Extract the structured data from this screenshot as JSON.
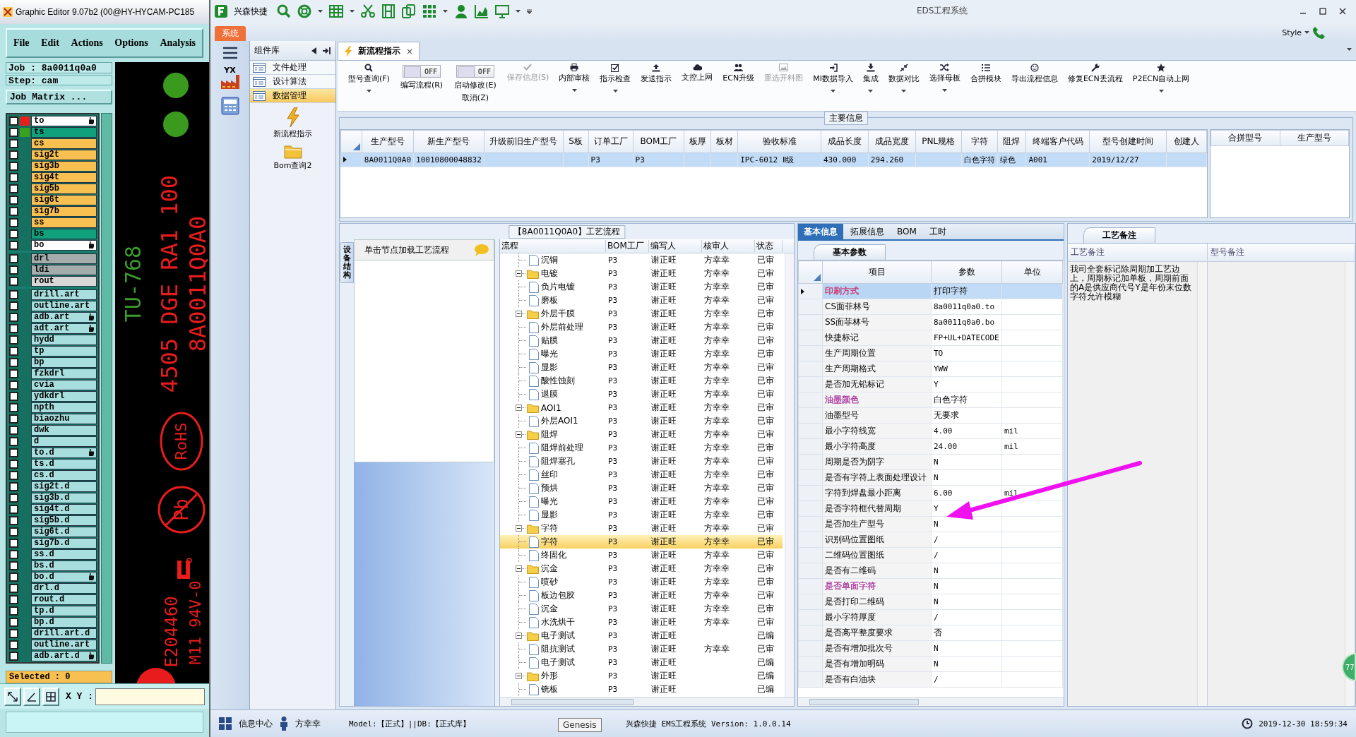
{
  "genesis": {
    "title": "Graphic Editor 9.07b2 (00@HY-HYCAM-PC185",
    "menu": [
      "File",
      "Edit",
      "Actions",
      "Options",
      "Analysis"
    ],
    "job": "Job : 8a0011q0a0",
    "step": "Step: cam",
    "matrix_button": "Job Matrix ...",
    "layer_groups": [
      [
        {
          "name": "to",
          "color": "#ffffff",
          "hand": true,
          "checked": false,
          "marker": {
            "color": "#e8201c"
          }
        },
        {
          "name": "ts",
          "color": "#10a07c",
          "hand": false,
          "checked": false,
          "marker": {
            "color": "#3aa020"
          }
        },
        {
          "name": "cs",
          "color": "#f8c050",
          "hand": false,
          "checked": false
        },
        {
          "name": "sig2t",
          "color": "#f8c050",
          "hand": false,
          "checked": false
        },
        {
          "name": "sig3b",
          "color": "#f8c050",
          "hand": false,
          "checked": false
        },
        {
          "name": "sig4t",
          "color": "#f8c050",
          "hand": false,
          "checked": false
        },
        {
          "name": "sig5b",
          "color": "#f8c050",
          "hand": false,
          "checked": false
        },
        {
          "name": "sig6t",
          "color": "#f8c050",
          "hand": false,
          "checked": false
        },
        {
          "name": "sig7b",
          "color": "#f8c050",
          "hand": false,
          "checked": false
        },
        {
          "name": "ss",
          "color": "#f8c050",
          "hand": false,
          "checked": false
        },
        {
          "name": "bs",
          "color": "#10a07c",
          "hand": false,
          "checked": false
        },
        {
          "name": "bo",
          "color": "#ffffff",
          "hand": true,
          "checked": false
        }
      ],
      [
        {
          "name": "drl",
          "color": "#a4acac",
          "hand": false,
          "checked": false
        },
        {
          "name": "ldi",
          "color": "#a4acac",
          "hand": false,
          "checked": false
        },
        {
          "name": "rout",
          "color": "#d8d8d8",
          "hand": false,
          "checked": false
        }
      ],
      [
        {
          "name": "drill.art",
          "color": "#a8dede",
          "hand": false,
          "checked": false
        },
        {
          "name": "outline.art",
          "color": "#a8dede",
          "hand": false,
          "checked": false
        },
        {
          "name": "adb.art",
          "color": "#a8dede",
          "hand": true,
          "checked": false
        },
        {
          "name": "adt.art",
          "color": "#a8dede",
          "hand": true,
          "checked": false
        },
        {
          "name": "hydd",
          "color": "#a8dede",
          "hand": false,
          "checked": false
        },
        {
          "name": "tp",
          "color": "#a8dede",
          "hand": false,
          "checked": false
        },
        {
          "name": "bp",
          "color": "#a8dede",
          "hand": false,
          "checked": false
        },
        {
          "name": "fzkdrl",
          "color": "#a8dede",
          "hand": false,
          "checked": false
        },
        {
          "name": "cvia",
          "color": "#a8dede",
          "hand": false,
          "checked": false
        },
        {
          "name": "ydkdrl",
          "color": "#a8dede",
          "hand": false,
          "checked": false
        },
        {
          "name": "npth",
          "color": "#a8dede",
          "hand": false,
          "checked": false
        },
        {
          "name": "biaozhu",
          "color": "#a8dede",
          "hand": false,
          "checked": false
        },
        {
          "name": "dwk",
          "color": "#a8dede",
          "hand": false,
          "checked": false
        },
        {
          "name": "d",
          "color": "#a8dede",
          "hand": false,
          "checked": false
        },
        {
          "name": "to.d",
          "color": "#a8dede",
          "hand": true,
          "checked": false
        },
        {
          "name": "ts.d",
          "color": "#a8dede",
          "hand": false,
          "checked": false
        },
        {
          "name": "cs.d",
          "color": "#a8dede",
          "hand": false,
          "checked": false
        },
        {
          "name": "sig2t.d",
          "color": "#a8dede",
          "hand": false,
          "checked": false
        },
        {
          "name": "sig3b.d",
          "color": "#a8dede",
          "hand": false,
          "checked": false
        },
        {
          "name": "sig4t.d",
          "color": "#a8dede",
          "hand": false,
          "checked": false
        },
        {
          "name": "sig5b.d",
          "color": "#a8dede",
          "hand": false,
          "checked": false
        },
        {
          "name": "sig6t.d",
          "color": "#a8dede",
          "hand": false,
          "checked": false
        },
        {
          "name": "sig7b.d",
          "color": "#a8dede",
          "hand": false,
          "checked": false
        },
        {
          "name": "ss.d",
          "color": "#a8dede",
          "hand": false,
          "checked": false
        },
        {
          "name": "bs.d",
          "color": "#a8dede",
          "hand": false,
          "checked": false
        },
        {
          "name": "bo.d",
          "color": "#a8dede",
          "hand": true,
          "checked": false
        },
        {
          "name": "drl.d",
          "color": "#a8dede",
          "hand": false,
          "checked": false
        },
        {
          "name": "rout.d",
          "color": "#a8dede",
          "hand": false,
          "checked": false
        },
        {
          "name": "tp.d",
          "color": "#a8dede",
          "hand": false,
          "checked": false
        },
        {
          "name": "bp.d",
          "color": "#a8dede",
          "hand": false,
          "checked": false
        },
        {
          "name": "drill.art.d",
          "color": "#a8dede",
          "hand": false,
          "checked": false
        },
        {
          "name": "outline.art",
          "color": "#a8dede",
          "hand": false,
          "checked": false
        },
        {
          "name": "adb.art.d",
          "color": "#a8dede",
          "hand": true,
          "checked": false
        }
      ]
    ],
    "selected": "Selected : 0",
    "xy_label": "X Y :",
    "canvas_texts": [
      {
        "kind": "line",
        "text": "TU-768",
        "color": "#3c9c2c"
      },
      {
        "kind": "line",
        "text": "4505 DGE RA1 100",
        "color": "#e81c1c"
      },
      {
        "kind": "line",
        "text": "8A0011Q0A0",
        "color": "#e81c1c"
      },
      {
        "kind": "rohs",
        "text": "RoHS",
        "color": "#e81c1c"
      },
      {
        "kind": "pb",
        "text": "Pb",
        "color": "#e81c1c"
      },
      {
        "kind": "line",
        "text": "E204460",
        "color": "#e81c1c"
      },
      {
        "kind": "line",
        "text": "M11 94V-0",
        "color": "#e81c1c"
      }
    ]
  },
  "app": {
    "brand": "兴森快捷",
    "title": "EDS工程系统",
    "system_tab": "系统",
    "style_menu": "Style",
    "nav_logo": "YX"
  },
  "library": {
    "header": "组件库",
    "items": [
      {
        "label": "文件处理",
        "selected": false
      },
      {
        "label": "设计算法",
        "selected": false
      },
      {
        "label": "数据管理",
        "selected": true
      }
    ],
    "shortcuts": [
      "新流程指示",
      "Bom查询2"
    ]
  },
  "doc_tab": {
    "label": "新流程指示",
    "close": "×"
  },
  "ribbon": [
    {
      "kind": "button",
      "label": "型号查询(F)",
      "dropdown": true,
      "disabled": false
    },
    {
      "kind": "toggle",
      "label": "编写流程(R)",
      "toggle_text": "OFF",
      "on": false
    },
    {
      "kind": "toggle",
      "label": "启动修改(E)",
      "sublabel": "取消(Z)",
      "toggle_text": "OFF",
      "on": false
    },
    {
      "kind": "button",
      "label": "保存信息(S)",
      "dropdown": false,
      "disabled": true
    },
    {
      "kind": "button",
      "label": "内部审核",
      "dropdown": true,
      "disabled": false
    },
    {
      "kind": "button",
      "label": "指示检查",
      "dropdown": true,
      "disabled": false
    },
    {
      "kind": "button",
      "label": "发送指示",
      "dropdown": false,
      "disabled": false
    },
    {
      "kind": "button",
      "label": "文控上网",
      "dropdown": false,
      "disabled": false
    },
    {
      "kind": "button",
      "label": "ECN升级",
      "dropdown": false,
      "disabled": false
    },
    {
      "kind": "button",
      "label": "重选开料图",
      "dropdown": false,
      "disabled": true
    },
    {
      "kind": "button",
      "label": "MI数据导入",
      "dropdown": true,
      "disabled": false
    },
    {
      "kind": "button",
      "label": "集成",
      "dropdown": true,
      "disabled": false
    },
    {
      "kind": "button",
      "label": "数据对比",
      "dropdown": true,
      "disabled": false
    },
    {
      "kind": "button",
      "label": "选择母板",
      "dropdown": true,
      "disabled": false
    },
    {
      "kind": "button",
      "label": "合拼模块",
      "dropdown": false,
      "disabled": false
    },
    {
      "kind": "button",
      "label": "导出流程信息",
      "dropdown": false,
      "disabled": false
    },
    {
      "kind": "button",
      "label": "修复ECN丢流程",
      "dropdown": false,
      "disabled": false
    },
    {
      "kind": "button",
      "label": "P2ECN自动上网",
      "dropdown": true,
      "disabled": false
    }
  ],
  "main_info": {
    "title": "主要信息",
    "columns": [
      "生产型号",
      "新生产型号",
      "升级前旧生产型号",
      "S板",
      "订单工厂",
      "BOM工厂",
      "板厚",
      "板材",
      "验收标准",
      "成品长度",
      "成品宽度",
      "PNL规格",
      "字符",
      "阻焊",
      "终端客户代码",
      "型号创建时间",
      "创建人"
    ],
    "rows": [
      {
        "selected": true,
        "cells": [
          "8A0011Q0A0",
          "10010800048832",
          null,
          null,
          "P3",
          "P3",
          null,
          null,
          "IPC-6012 Ⅱ级",
          "430.000",
          "294.260",
          null,
          "白色字符",
          "绿色",
          "A001",
          "2019/12/27",
          null
        ]
      }
    ],
    "side_columns": [
      "合拼型号",
      "生产型号"
    ]
  },
  "process": {
    "title": "【8A0011Q0A0】工艺流程",
    "side_tab": "设备结构",
    "hint": "单击节点加载工艺流程",
    "columns": [
      "流程",
      "BOM工厂",
      "编写人",
      "核审人",
      "状态"
    ],
    "rows": [
      {
        "kind": "file",
        "label": "沉铜",
        "selected": false,
        "bom": "P3",
        "writer": "谢正旺",
        "reviewer": "方幸幸",
        "status": "已审"
      },
      {
        "kind": "folder",
        "label": "电镀",
        "expanded": true,
        "selected": false,
        "bom": "P3",
        "writer": "谢正旺",
        "reviewer": "方幸幸",
        "status": "已审",
        "children": [
          {
            "kind": "file",
            "label": "负片电镀",
            "selected": false,
            "bom": "P3",
            "writer": "谢正旺",
            "reviewer": "方幸幸",
            "status": "已审"
          },
          {
            "kind": "file",
            "label": "磨板",
            "selected": false,
            "bom": "P3",
            "writer": "谢正旺",
            "reviewer": "方幸幸",
            "status": "已审"
          }
        ]
      },
      {
        "kind": "folder",
        "label": "外层干膜",
        "expanded": true,
        "selected": false,
        "bom": "P3",
        "writer": "谢正旺",
        "reviewer": "方幸幸",
        "status": "已审",
        "children": [
          {
            "kind": "file",
            "label": "外层前处理",
            "selected": false,
            "bom": "P3",
            "writer": "谢正旺",
            "reviewer": "方幸幸",
            "status": "已审"
          },
          {
            "kind": "file",
            "label": "贴膜",
            "selected": false,
            "bom": "P3",
            "writer": "谢正旺",
            "reviewer": "方幸幸",
            "status": "已审"
          },
          {
            "kind": "file",
            "label": "曝光",
            "selected": false,
            "bom": "P3",
            "writer": "谢正旺",
            "reviewer": "方幸幸",
            "status": "已审"
          },
          {
            "kind": "file",
            "label": "显影",
            "selected": false,
            "bom": "P3",
            "writer": "谢正旺",
            "reviewer": "方幸幸",
            "status": "已审"
          },
          {
            "kind": "file",
            "label": "酸性蚀刻",
            "selected": false,
            "bom": "P3",
            "writer": "谢正旺",
            "reviewer": "方幸幸",
            "status": "已审"
          },
          {
            "kind": "file",
            "label": "退膜",
            "selected": false,
            "bom": "P3",
            "writer": "谢正旺",
            "reviewer": "方幸幸",
            "status": "已审"
          }
        ]
      },
      {
        "kind": "folder",
        "label": "AOI1",
        "expanded": true,
        "selected": false,
        "bom": "P3",
        "writer": "谢正旺",
        "reviewer": "方幸幸",
        "status": "已审",
        "children": [
          {
            "kind": "file",
            "label": "外层AOI1",
            "selected": false,
            "bom": "P3",
            "writer": "谢正旺",
            "reviewer": "方幸幸",
            "status": "已审"
          }
        ]
      },
      {
        "kind": "folder",
        "label": "阻焊",
        "expanded": true,
        "selected": false,
        "bom": "P3",
        "writer": "谢正旺",
        "reviewer": "方幸幸",
        "status": "已审",
        "children": [
          {
            "kind": "file",
            "label": "阻焊前处理",
            "selected": false,
            "bom": "P3",
            "writer": "谢正旺",
            "reviewer": "方幸幸",
            "status": "已审"
          },
          {
            "kind": "file",
            "label": "阻焊塞孔",
            "selected": false,
            "bom": "P3",
            "writer": "谢正旺",
            "reviewer": "方幸幸",
            "status": "已审"
          },
          {
            "kind": "file",
            "label": "丝印",
            "selected": false,
            "bom": "P3",
            "writer": "谢正旺",
            "reviewer": "方幸幸",
            "status": "已审"
          },
          {
            "kind": "file",
            "label": "预烘",
            "selected": false,
            "bom": "P3",
            "writer": "谢正旺",
            "reviewer": "方幸幸",
            "status": "已审"
          },
          {
            "kind": "file",
            "label": "曝光",
            "selected": false,
            "bom": "P3",
            "writer": "谢正旺",
            "reviewer": "方幸幸",
            "status": "已审"
          },
          {
            "kind": "file",
            "label": "显影",
            "selected": false,
            "bom": "P3",
            "writer": "谢正旺",
            "reviewer": "方幸幸",
            "status": "已审"
          }
        ]
      },
      {
        "kind": "folder",
        "label": "字符",
        "expanded": true,
        "selected": false,
        "bom": "P3",
        "writer": "谢正旺",
        "reviewer": "方幸幸",
        "status": "已审",
        "children": [
          {
            "kind": "file",
            "label": "字符",
            "selected": true,
            "bom": "P3",
            "writer": "谢正旺",
            "reviewer": "方幸幸",
            "status": "已审"
          },
          {
            "kind": "file",
            "label": "终固化",
            "selected": false,
            "bom": "P3",
            "writer": "谢正旺",
            "reviewer": "方幸幸",
            "status": "已审"
          }
        ]
      },
      {
        "kind": "folder",
        "label": "沉金",
        "expanded": true,
        "selected": false,
        "bom": "P3",
        "writer": "谢正旺",
        "reviewer": "方幸幸",
        "status": "已审",
        "children": [
          {
            "kind": "file",
            "label": "喷砂",
            "selected": false,
            "bom": "P3",
            "writer": "谢正旺",
            "reviewer": "方幸幸",
            "status": "已审"
          },
          {
            "kind": "file",
            "label": "板边包胶",
            "selected": false,
            "bom": "P3",
            "writer": "谢正旺",
            "reviewer": "方幸幸",
            "status": "已审"
          },
          {
            "kind": "file",
            "label": "沉金",
            "selected": false,
            "bom": "P3",
            "writer": "谢正旺",
            "reviewer": "方幸幸",
            "status": "已审"
          },
          {
            "kind": "file",
            "label": "水洗烘干",
            "selected": false,
            "bom": "P3",
            "writer": "谢正旺",
            "reviewer": "方幸幸",
            "status": "已审"
          }
        ]
      },
      {
        "kind": "folder",
        "label": "电子测试",
        "expanded": true,
        "selected": false,
        "bom": "P3",
        "writer": "谢正旺",
        "status": "已编",
        "children": [
          {
            "kind": "file",
            "label": "阻抗测试",
            "selected": false,
            "bom": "P3",
            "writer": "谢正旺",
            "reviewer": "方幸幸",
            "status": "已审"
          },
          {
            "kind": "file",
            "label": "电子测试",
            "selected": false,
            "bom": "P3",
            "writer": "谢正旺",
            "status": "已编"
          }
        ]
      },
      {
        "kind": "folder",
        "label": "外形",
        "expanded": true,
        "selected": false,
        "bom": "P3",
        "writer": "谢正旺",
        "status": "已编",
        "children": [
          {
            "kind": "file",
            "label": "铣板",
            "selected": false,
            "bom": "P3",
            "writer": "谢正旺",
            "status": "已编"
          }
        ]
      }
    ]
  },
  "details": {
    "tabs": [
      {
        "label": "基本信息",
        "selected": true
      },
      {
        "label": "拓展信息",
        "selected": false
      },
      {
        "label": "BOM",
        "selected": false
      },
      {
        "label": "工时",
        "selected": false
      }
    ],
    "group_tab": "基本参数",
    "columns": [
      "项目",
      "参数",
      "单位"
    ],
    "rows": [
      {
        "name": "印刷方式",
        "value": "打印字符",
        "color": "#c8306c",
        "selected": true
      },
      {
        "name": "CS面菲林号",
        "value": "8a0011q0a0.to",
        "selected": false
      },
      {
        "name": "SS面菲林号",
        "value": "8a0011q0a0.bo",
        "selected": false
      },
      {
        "name": "快捷标记",
        "value": "FP+UL+DATECODE",
        "selected": false
      },
      {
        "name": "生产周期位置",
        "value": "TO",
        "selected": false
      },
      {
        "name": "生产周期格式",
        "value": "YWW",
        "selected": false
      },
      {
        "name": "是否加无铅标记",
        "value": "Y",
        "selected": false
      },
      {
        "name": "油墨颜色",
        "value": "白色字符",
        "color": "#a8309c",
        "selected": false
      },
      {
        "name": "油墨型号",
        "value": "无要求",
        "selected": false
      },
      {
        "name": "最小字符线宽",
        "value": "4.00",
        "unit": "mil",
        "selected": false
      },
      {
        "name": "最小字符高度",
        "value": "24.00",
        "unit": "mil",
        "selected": false
      },
      {
        "name": "周期是否为阴字",
        "value": "N",
        "selected": false
      },
      {
        "name": "是否有字符上表面处理设计",
        "value": "N",
        "selected": false
      },
      {
        "name": "字符到焊盘最小距离",
        "value": "6.00",
        "unit": "mil",
        "selected": false
      },
      {
        "name": "是否字符框代替周期",
        "value": "Y",
        "selected": false
      },
      {
        "name": "是否加生产型号",
        "value": "N",
        "selected": false
      },
      {
        "name": "识别码位置图纸",
        "value": "/",
        "selected": false
      },
      {
        "name": "二维码位置图纸",
        "value": "/",
        "selected": false
      },
      {
        "name": "是否有二维码",
        "value": "N",
        "selected": false
      },
      {
        "name": "是否单面字符",
        "value": "N",
        "color": "#a8309c",
        "selected": false
      },
      {
        "name": "是否打印二维码",
        "value": "N",
        "selected": false
      },
      {
        "name": "最小字符厚度",
        "value": "/",
        "selected": false
      },
      {
        "name": "是否高平整度要求",
        "value": "否",
        "selected": false
      },
      {
        "name": "是否有增加批次号",
        "value": "N",
        "selected": false
      },
      {
        "name": "是否有增加明码",
        "value": "N",
        "selected": false
      },
      {
        "name": "是否有白油块",
        "value": "/",
        "selected": false
      }
    ]
  },
  "notes": {
    "tab": "工艺备注",
    "columns": [
      "工艺备注",
      "型号备注"
    ],
    "text": "我司全套标记除周期加工艺边上，周期标记加单板，周期前面的A是供应商代号Y是年份末位数字符允许模糊"
  },
  "status": {
    "info": "信息中心",
    "user": "方幸幸",
    "model": "Model:【正式】||DB:【正式库】",
    "tooltip": "Genesis",
    "version": "兴森快捷 EMS工程系统 Version: 1.0.0.14",
    "time": "2019-12-30 18:59:34"
  },
  "badge": "77"
}
